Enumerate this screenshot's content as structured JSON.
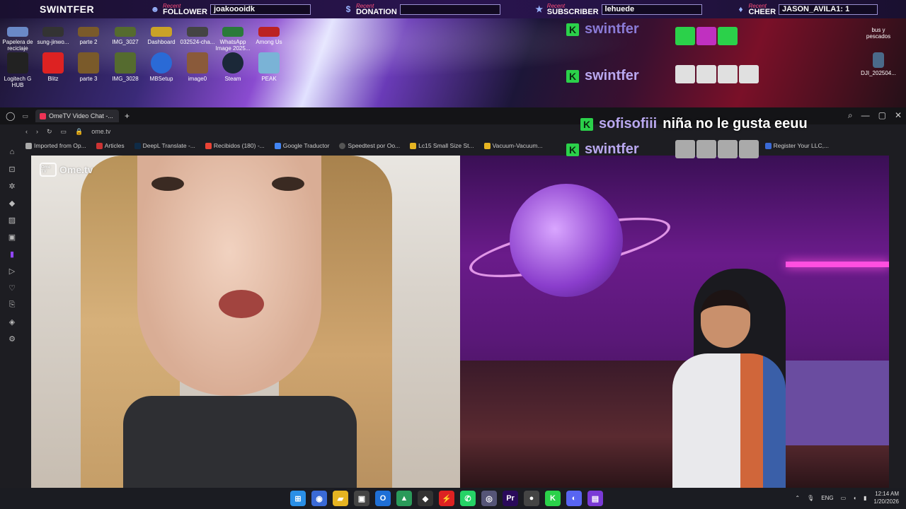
{
  "alerts": {
    "brand": "SWINTFER",
    "follower": {
      "tag": "Recent",
      "label": "FOLLOWER",
      "value": "joakoooidk"
    },
    "donation": {
      "tag": "Recent",
      "label": "DONATION",
      "value": ""
    },
    "subscriber": {
      "tag": "Recent",
      "label": "SUBSCRIBER",
      "value": "lehuede"
    },
    "cheer": {
      "tag": "Recent",
      "label": "CHEER",
      "value": "JASON_AVILA1: 1"
    }
  },
  "desktop": {
    "icons": [
      {
        "label": "Papelera de reciclaje",
        "color": "#6a89c7"
      },
      {
        "label": "sung-jinwo...",
        "color": "#333"
      },
      {
        "label": "parte 2",
        "color": "#7a5a2a"
      },
      {
        "label": "IMG_3027",
        "color": "#556b2f"
      },
      {
        "label": "Dashboard",
        "color": "#c9a227"
      },
      {
        "label": "032524-cha...",
        "color": "#444"
      },
      {
        "label": "WhatsApp Image 2025...",
        "color": "#2a7a3a"
      },
      {
        "label": "Among Us",
        "color": "#b22"
      },
      {
        "label": "Logitech G HUB",
        "color": "#222"
      },
      {
        "label": "Blitz",
        "color": "#d22"
      },
      {
        "label": "parte 3",
        "color": "#7a5a2a"
      },
      {
        "label": "IMG_3028",
        "color": "#556b2f"
      },
      {
        "label": "MBSetup",
        "color": "#2a6ad6"
      },
      {
        "label": "image0",
        "color": "#8a5a3a"
      },
      {
        "label": "Steam",
        "color": "#1b2838"
      },
      {
        "label": "PEAK",
        "color": "#7ab3d6"
      }
    ],
    "right_icons": [
      {
        "label": "bus y pescados"
      },
      {
        "label": "DJI_202504..."
      }
    ]
  },
  "chat": {
    "lines": [
      {
        "user": "swintfer",
        "message": ""
      },
      {
        "user": "swintfer",
        "message": ""
      },
      {
        "user": "sofisofiii",
        "message": "niña no le gusta eeuu"
      },
      {
        "user": "swintfer",
        "message": ""
      }
    ],
    "user_color_1": "#8a7bd6",
    "user_color_2": "#b9a8ef"
  },
  "browser": {
    "tab_title": "OmeTV Video Chat -...",
    "new_tab": "+",
    "url": "ome.tv",
    "bookmarks": [
      "Imported from Op...",
      "Articles",
      "DeepL Translate -...",
      "Recibidos (180) -...",
      "Google Traductor",
      "Speedtest por Oo...",
      "Lc15 Small Size St...",
      "Vacuum-Vacuum...",
      "Register Your LLC,..."
    ],
    "page": {
      "logo_text": "Ome.tv",
      "logo_badge": "Ome TV"
    }
  },
  "taskbar": {
    "language": "ENG",
    "time": "12:14 AM",
    "date": "1/20/2026",
    "apps": [
      {
        "name": "start-icon",
        "glyph": "⊞",
        "color": "#2a8fe6"
      },
      {
        "name": "browser-icon",
        "glyph": "◉",
        "color": "#3a6ad6"
      },
      {
        "name": "file-explorer-icon",
        "glyph": "▰",
        "color": "#e6b422"
      },
      {
        "name": "store-icon",
        "glyph": "▣",
        "color": "#444"
      },
      {
        "name": "outlook-icon",
        "glyph": "O",
        "color": "#1f6fd6"
      },
      {
        "name": "app-icon",
        "glyph": "▲",
        "color": "#2a9a5a"
      },
      {
        "name": "capcut-icon",
        "glyph": "◆",
        "color": "#333"
      },
      {
        "name": "blitz-icon",
        "glyph": "⚡",
        "color": "#d22"
      },
      {
        "name": "whatsapp-icon",
        "glyph": "✆",
        "color": "#25d366"
      },
      {
        "name": "vpn-icon",
        "glyph": "◎",
        "color": "#557"
      },
      {
        "name": "premiere-icon",
        "glyph": "Pr",
        "color": "#2a0a5a"
      },
      {
        "name": "obs-icon",
        "glyph": "●",
        "color": "#444"
      },
      {
        "name": "kick-icon",
        "glyph": "K",
        "color": "#2bd14a"
      },
      {
        "name": "discord-icon",
        "glyph": "◐",
        "color": "#5865f2"
      },
      {
        "name": "stream-icon",
        "glyph": "▤",
        "color": "#7a3ad6"
      }
    ]
  }
}
